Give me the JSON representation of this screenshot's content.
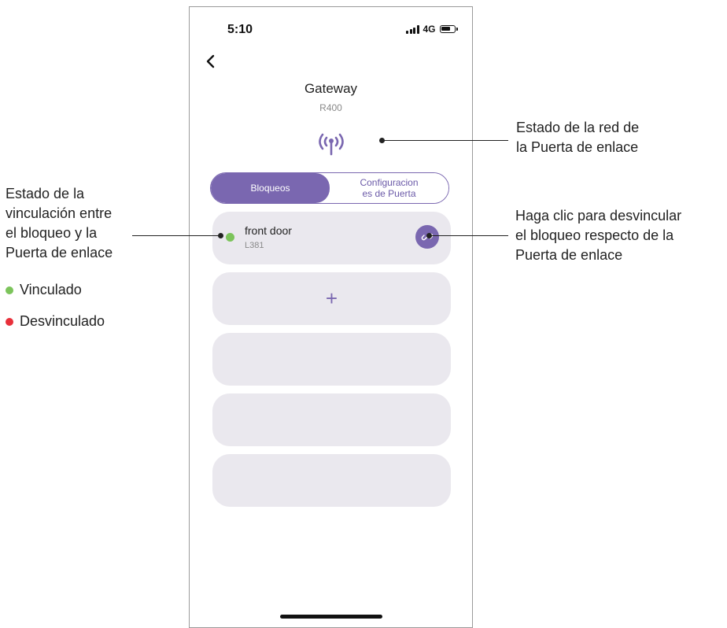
{
  "status_bar": {
    "time": "5:10",
    "network": "4G"
  },
  "header": {
    "title": "Gateway",
    "subtitle": "R400",
    "network_status_icon": "antenna-icon"
  },
  "tabs": [
    {
      "label": "Bloqueos",
      "active": true
    },
    {
      "label": "Configuracion\nes de Puerta",
      "active": false
    }
  ],
  "locks": [
    {
      "name": "front door",
      "model": "L381",
      "status": "linked",
      "status_color": "#7cc45b"
    }
  ],
  "add_button": {
    "label": "+"
  },
  "colors": {
    "accent": "#7a67b0",
    "card": "#eae8ee",
    "linked": "#7cc45b",
    "unlinked": "#e8303a"
  },
  "annotations": {
    "network": "Estado de la red de\nla Puerta de enlace",
    "link_status": "Estado de la\nvinculación entre\nel bloqueo y la\nPuerta de enlace",
    "unlink": "Haga clic para desvincular\nel bloqueo respecto de la\nPuerta de enlace",
    "legend_linked": "Vinculado",
    "legend_unlinked": "Desvinculado"
  }
}
